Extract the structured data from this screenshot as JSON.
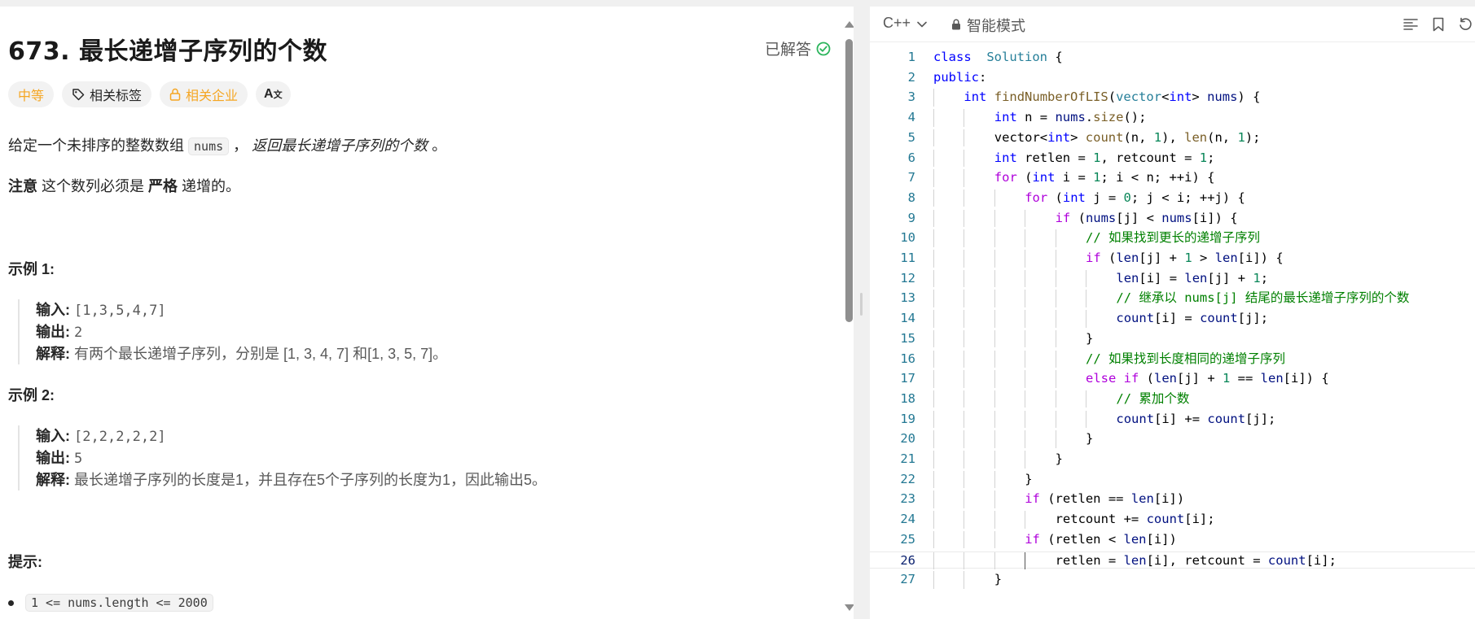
{
  "problem": {
    "title": "673. 最长递增子序列的个数",
    "status": "已解答",
    "difficulty": "中等",
    "tags_label": "相关标签",
    "companies_label": "相关企业",
    "translate_glyph": "Aあ"
  },
  "description": {
    "line1_prefix": "给定一个未排序的整数数组",
    "line1_code": "nums",
    "line1_sep": "，",
    "line1_emph": "返回最长递增子序列的个数",
    "line1_suffix": "。",
    "note_label": "注意",
    "note_mid": "这个数列必须是",
    "note_bold": "严格",
    "note_end": "递增的。"
  },
  "examples": [
    {
      "heading": "示例 1:",
      "input_label": "输入:",
      "input": "[1,3,5,4,7]",
      "output_label": "输出:",
      "output": "2",
      "explain_label": "解释:",
      "explain": "有两个最长递增子序列，分别是 [1, 3, 4, 7] 和[1, 3, 5, 7]。"
    },
    {
      "heading": "示例 2:",
      "input_label": "输入:",
      "input": "[2,2,2,2,2]",
      "output_label": "输出:",
      "output": "5",
      "explain_label": "解释:",
      "explain": "最长递增子序列的长度是1，并且存在5个子序列的长度为1，因此输出5。"
    }
  ],
  "hints": {
    "heading": "提示:",
    "items": [
      "1 <= nums.length <= 2000"
    ]
  },
  "editor": {
    "language": "C++",
    "mode": "智能模式",
    "current_line": 26,
    "lines": [
      {
        "n": "1",
        "indent": 0,
        "tokens": [
          [
            "kw",
            "class"
          ],
          [
            "",
            "  "
          ],
          [
            "ty",
            "Solution"
          ],
          [
            "",
            " {"
          ]
        ]
      },
      {
        "n": "2",
        "indent": 0,
        "tokens": [
          [
            "kw",
            "public"
          ],
          [
            "",
            ":"
          ]
        ]
      },
      {
        "n": "3",
        "indent": 1,
        "tokens": [
          [
            "kw",
            "int"
          ],
          [
            "",
            " "
          ],
          [
            "fn",
            "findNumberOfLIS"
          ],
          [
            "",
            "("
          ],
          [
            "ty",
            "vector"
          ],
          [
            "",
            "<"
          ],
          [
            "kw",
            "int"
          ],
          [
            "",
            "&gt; "
          ],
          [
            "var",
            "nums"
          ],
          [
            "",
            ") {"
          ]
        ]
      },
      {
        "n": "4",
        "indent": 2,
        "tokens": [
          [
            "kw",
            "int"
          ],
          [
            "",
            " n = "
          ],
          [
            "var",
            "nums"
          ],
          [
            "",
            "."
          ],
          [
            "fn",
            "size"
          ],
          [
            "",
            "();"
          ]
        ]
      },
      {
        "n": "5",
        "indent": 2,
        "tokens": [
          [
            "",
            "vector<"
          ],
          [
            "kw",
            "int"
          ],
          [
            "",
            "> "
          ],
          [
            "fn",
            "count"
          ],
          [
            "",
            "(n, "
          ],
          [
            "num",
            "1"
          ],
          [
            "",
            "), "
          ],
          [
            "fn",
            "len"
          ],
          [
            "",
            "(n, "
          ],
          [
            "num",
            "1"
          ],
          [
            "",
            ");"
          ]
        ]
      },
      {
        "n": "6",
        "indent": 2,
        "tokens": [
          [
            "kw",
            "int"
          ],
          [
            "",
            " retlen = "
          ],
          [
            "num",
            "1"
          ],
          [
            "",
            ", retcount = "
          ],
          [
            "num",
            "1"
          ],
          [
            "",
            ";"
          ]
        ]
      },
      {
        "n": "7",
        "indent": 2,
        "tokens": [
          [
            "ctl",
            "for"
          ],
          [
            "",
            " ("
          ],
          [
            "kw",
            "int"
          ],
          [
            "",
            " i = "
          ],
          [
            "num",
            "1"
          ],
          [
            "",
            "; i < n; ++i) {"
          ]
        ]
      },
      {
        "n": "8",
        "indent": 3,
        "tokens": [
          [
            "ctl",
            "for"
          ],
          [
            "",
            " ("
          ],
          [
            "kw",
            "int"
          ],
          [
            "",
            " j = "
          ],
          [
            "num",
            "0"
          ],
          [
            "",
            "; j < i; ++j) {"
          ]
        ]
      },
      {
        "n": "9",
        "indent": 4,
        "tokens": [
          [
            "ctl",
            "if"
          ],
          [
            "",
            " ("
          ],
          [
            "var",
            "nums"
          ],
          [
            "",
            "[j] < "
          ],
          [
            "var",
            "nums"
          ],
          [
            "",
            "[i]) {"
          ]
        ]
      },
      {
        "n": "10",
        "indent": 5,
        "tokens": [
          [
            "cm",
            "// 如果找到更长的递增子序列"
          ]
        ]
      },
      {
        "n": "11",
        "indent": 5,
        "tokens": [
          [
            "ctl",
            "if"
          ],
          [
            "",
            " ("
          ],
          [
            "var",
            "len"
          ],
          [
            "",
            "[j] + "
          ],
          [
            "num",
            "1"
          ],
          [
            "",
            " > "
          ],
          [
            "var",
            "len"
          ],
          [
            "",
            "[i]) {"
          ]
        ]
      },
      {
        "n": "12",
        "indent": 6,
        "tokens": [
          [
            "var",
            "len"
          ],
          [
            "",
            "[i] = "
          ],
          [
            "var",
            "len"
          ],
          [
            "",
            "[j] + "
          ],
          [
            "num",
            "1"
          ],
          [
            "",
            ";"
          ]
        ]
      },
      {
        "n": "13",
        "indent": 6,
        "tokens": [
          [
            "cm",
            "// 继承以 nums[j] 结尾的最长递增子序列的个数"
          ]
        ]
      },
      {
        "n": "14",
        "indent": 6,
        "tokens": [
          [
            "var",
            "count"
          ],
          [
            "",
            "[i] = "
          ],
          [
            "var",
            "count"
          ],
          [
            "",
            "[j];"
          ]
        ]
      },
      {
        "n": "15",
        "indent": 5,
        "tokens": [
          [
            "",
            "}"
          ]
        ]
      },
      {
        "n": "16",
        "indent": 5,
        "tokens": [
          [
            "cm",
            "// 如果找到长度相同的递增子序列"
          ]
        ]
      },
      {
        "n": "17",
        "indent": 5,
        "tokens": [
          [
            "ctl",
            "else if"
          ],
          [
            "",
            " ("
          ],
          [
            "var",
            "len"
          ],
          [
            "",
            "[j] + "
          ],
          [
            "num",
            "1"
          ],
          [
            "",
            " == "
          ],
          [
            "var",
            "len"
          ],
          [
            "",
            "[i]) {"
          ]
        ]
      },
      {
        "n": "18",
        "indent": 6,
        "tokens": [
          [
            "cm",
            "// 累加个数"
          ]
        ]
      },
      {
        "n": "19",
        "indent": 6,
        "tokens": [
          [
            "var",
            "count"
          ],
          [
            "",
            "[i] += "
          ],
          [
            "var",
            "count"
          ],
          [
            "",
            "[j];"
          ]
        ]
      },
      {
        "n": "20",
        "indent": 5,
        "tokens": [
          [
            "",
            "}"
          ]
        ]
      },
      {
        "n": "21",
        "indent": 4,
        "tokens": [
          [
            "",
            "}"
          ]
        ]
      },
      {
        "n": "22",
        "indent": 3,
        "tokens": [
          [
            "",
            "}"
          ]
        ]
      },
      {
        "n": "23",
        "indent": 3,
        "tokens": [
          [
            "ctl",
            "if"
          ],
          [
            "",
            " (retlen == "
          ],
          [
            "var",
            "len"
          ],
          [
            "",
            "[i])"
          ]
        ]
      },
      {
        "n": "24",
        "indent": 4,
        "tokens": [
          [
            "",
            "retcount += "
          ],
          [
            "var",
            "count"
          ],
          [
            "",
            "[i];"
          ]
        ]
      },
      {
        "n": "25",
        "indent": 3,
        "tokens": [
          [
            "ctl",
            "if"
          ],
          [
            "",
            " (retlen < "
          ],
          [
            "var",
            "len"
          ],
          [
            "",
            "[i])"
          ]
        ]
      },
      {
        "n": "26",
        "indent": 4,
        "tokens": [
          [
            "",
            "retlen = "
          ],
          [
            "var",
            "len"
          ],
          [
            "",
            "[i], retcount = "
          ],
          [
            "var",
            "count"
          ],
          [
            "",
            "[i];"
          ]
        ]
      },
      {
        "n": "27",
        "indent": 2,
        "tokens": [
          [
            "",
            "}"
          ]
        ]
      }
    ]
  },
  "colors": {
    "accent_green": "#2db55d",
    "difficulty_orange": "#f5a623",
    "line_number": "#237893"
  }
}
